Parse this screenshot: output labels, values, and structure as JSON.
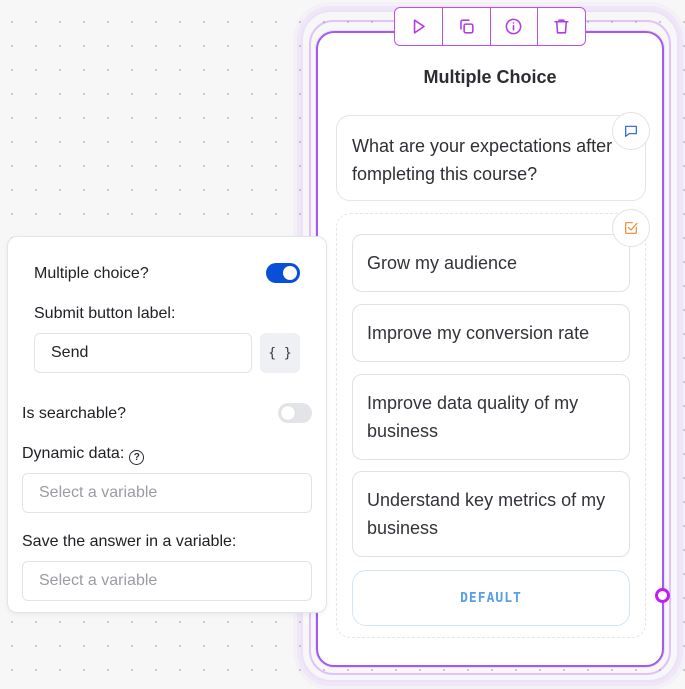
{
  "block": {
    "title": "Multiple Choice",
    "question": "What are your expectations after fompleting this course?",
    "choices": [
      "Grow my audience",
      "Improve my conversion rate",
      "Improve data quality of my business",
      "Understand key metrics of my business"
    ],
    "default_label": "DEFAULT"
  },
  "toolbar": {
    "icons": [
      "play-icon",
      "duplicate-icon",
      "info-icon",
      "trash-icon"
    ]
  },
  "settings": {
    "multiple_choice_label": "Multiple choice?",
    "multiple_choice_enabled": true,
    "submit_label_label": "Submit button label:",
    "submit_label_value": "Send",
    "variable_button": "{ }",
    "searchable_label": "Is searchable?",
    "searchable_enabled": false,
    "dynamic_data_label": "Dynamic data:",
    "dynamic_data_placeholder": "Select a variable",
    "save_answer_label": "Save the answer in a variable:",
    "save_answer_placeholder": "Select a variable"
  },
  "colors": {
    "accent_purple": "#a35af0",
    "toggle_on": "#0a4fd8",
    "default_text": "#5a9ee8"
  }
}
